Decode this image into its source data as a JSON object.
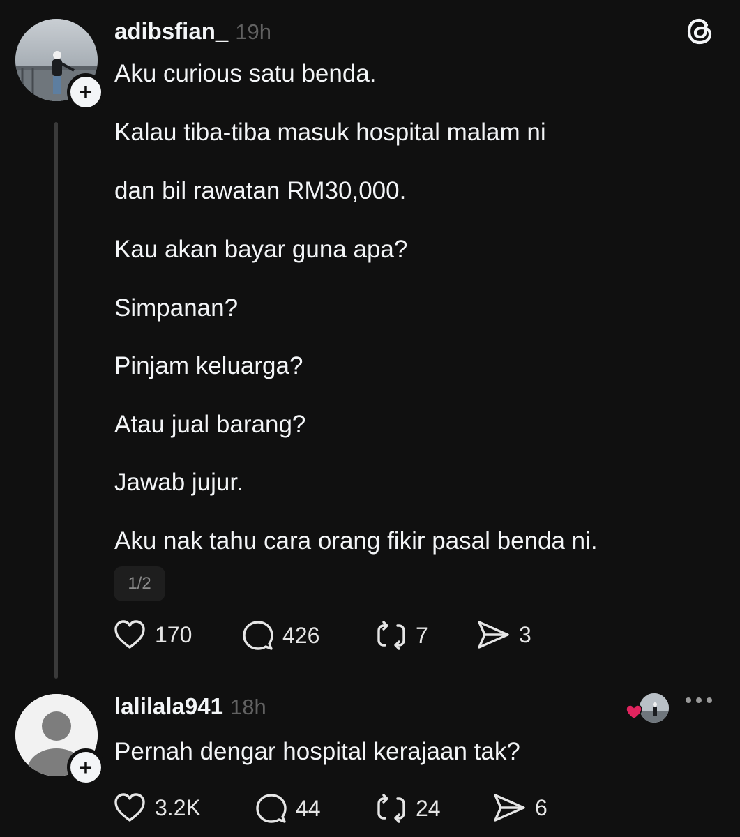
{
  "post": {
    "username": "adibsfian_",
    "time": "19h",
    "lines": [
      "Aku curious satu benda.",
      "Kalau tiba-tiba masuk hospital malam ni",
      "dan bil rawatan RM30,000.",
      "Kau akan bayar guna apa?",
      "Simpanan?",
      "Pinjam keluarga?",
      "Atau jual barang?",
      "Jawab jujur.",
      "Aku nak tahu cara orang fikir pasal benda ni."
    ],
    "page_indicator": "1/2",
    "likes": "170",
    "replies": "426",
    "reposts": "7",
    "shares": "3",
    "follow_symbol": "+"
  },
  "reply": {
    "username": "lalilala941",
    "time": "18h",
    "text": "Pernah dengar hospital kerajaan tak?",
    "likes": "3.2K",
    "replies": "44",
    "reposts": "24",
    "shares": "6",
    "follow_symbol": "+"
  },
  "icons": {
    "app_logo": "threads-logo-icon",
    "like": "heart-outline-icon",
    "reply": "speech-bubble-icon",
    "repost": "repost-arrows-icon",
    "share": "paper-plane-icon",
    "liked_by_author": "red-heart-icon",
    "more": "more-dots-icon"
  },
  "colors": {
    "background": "#101010",
    "text": "#f3f5f7",
    "muted": "#616161",
    "liked_heart": "#e0245e"
  }
}
